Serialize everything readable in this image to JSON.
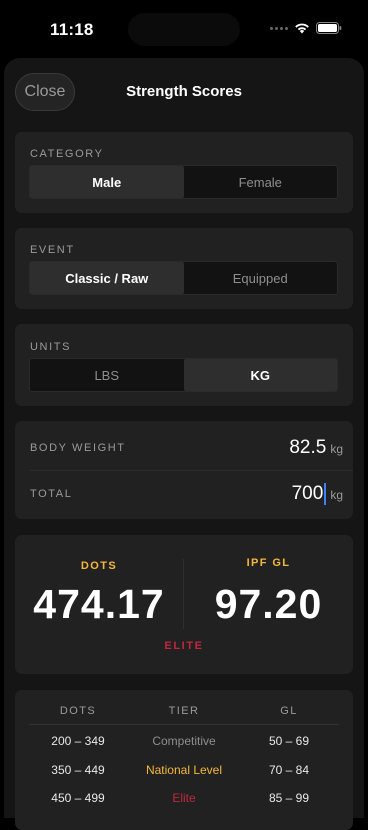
{
  "status_bar": {
    "time": "11:18"
  },
  "nav": {
    "close_label": "Close",
    "title": "Strength Scores"
  },
  "category": {
    "label": "CATEGORY",
    "options": [
      "Male",
      "Female"
    ],
    "selected": "Male"
  },
  "event": {
    "label": "EVENT",
    "options": [
      "Classic / Raw",
      "Equipped"
    ],
    "selected": "Classic / Raw"
  },
  "units": {
    "label": "UNITS",
    "options": [
      "LBS",
      "KG"
    ],
    "selected": "KG"
  },
  "inputs": {
    "body_weight": {
      "label": "BODY WEIGHT",
      "value": "82.5",
      "unit": "kg"
    },
    "total": {
      "label": "TOTAL",
      "value": "700",
      "unit": "kg"
    }
  },
  "scores": {
    "dots": {
      "label": "DOTS",
      "value": "474.17"
    },
    "ipf_gl": {
      "label": "IPF GL",
      "value": "97.20"
    },
    "tier": "ELITE"
  },
  "colors": {
    "accent_gold": "#f5b83d",
    "elite_red": "#c0283e",
    "caret_blue": "#3b82f6"
  },
  "tier_table": {
    "headers": [
      "DOTS",
      "TIER",
      "GL"
    ],
    "rows": [
      {
        "dots": "200 – 349",
        "tier": "Competitive",
        "gl": "50 – 69",
        "tier_color": "#8e8e8e"
      },
      {
        "dots": "350 – 449",
        "tier": "National Level",
        "gl": "70 – 84",
        "tier_color": "#f5b83d"
      },
      {
        "dots": "450 – 499",
        "tier": "Elite",
        "gl": "85 – 99",
        "tier_color": "#c0283e"
      }
    ]
  }
}
